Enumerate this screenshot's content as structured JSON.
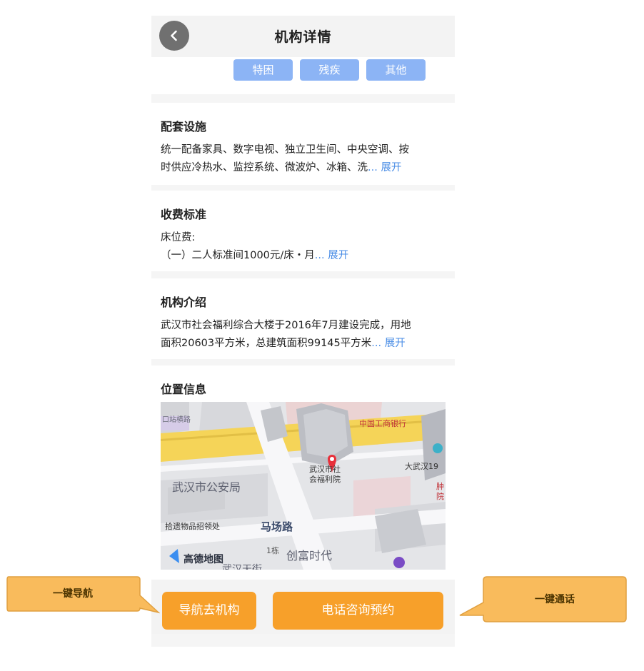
{
  "header": {
    "title": "机构详情"
  },
  "tags": [
    "特困",
    "残疾",
    "其他"
  ],
  "facilities": {
    "title": "配套设施",
    "line1": "统一配备家具、数字电视、独立卫生间、中央空调、按",
    "line2": "时供应冷热水、监控系统、微波炉、冰箱、洗",
    "ellipsis": "...",
    "expand": "展开"
  },
  "fees": {
    "title": "收费标准",
    "line1": "床位费:",
    "line2": "（一）二人标准间1000元/床・月",
    "ellipsis": "...",
    "expand": "展开"
  },
  "intro": {
    "title": "机构介绍",
    "line1": "武汉市社会福利综合大楼于2016年7月建设完成，用地",
    "line2": "面积20603平方米，总建筑面积99145平方米",
    "ellipsis": "...",
    "expand": "展开"
  },
  "location": {
    "title": "位置信息",
    "map_labels": {
      "station_road": "口站横路",
      "bank": "中国工商银行",
      "welfare_1": "武汉市社",
      "welfare_2": "会福利院",
      "big_wuhan": "大武汉19",
      "side_1": "肿",
      "side_2": "院",
      "police": "武汉市公安局",
      "lost_found": "拾遗物品招领处",
      "road": "马场路",
      "building": "1栋",
      "chuangfu": "创富时代",
      "bottom_street": "武汉天街",
      "brand": "高德地图"
    }
  },
  "bottom": {
    "nav_label": "导航去机构",
    "call_label": "电话咨询预约"
  },
  "callouts": {
    "nav": "一键导航",
    "call": "一键通话"
  },
  "colors": {
    "accent_orange": "#f7a02a",
    "tag_blue": "#8cb4f5",
    "link_blue": "#4a8de6",
    "callout_fill": "#f9bb5c"
  }
}
